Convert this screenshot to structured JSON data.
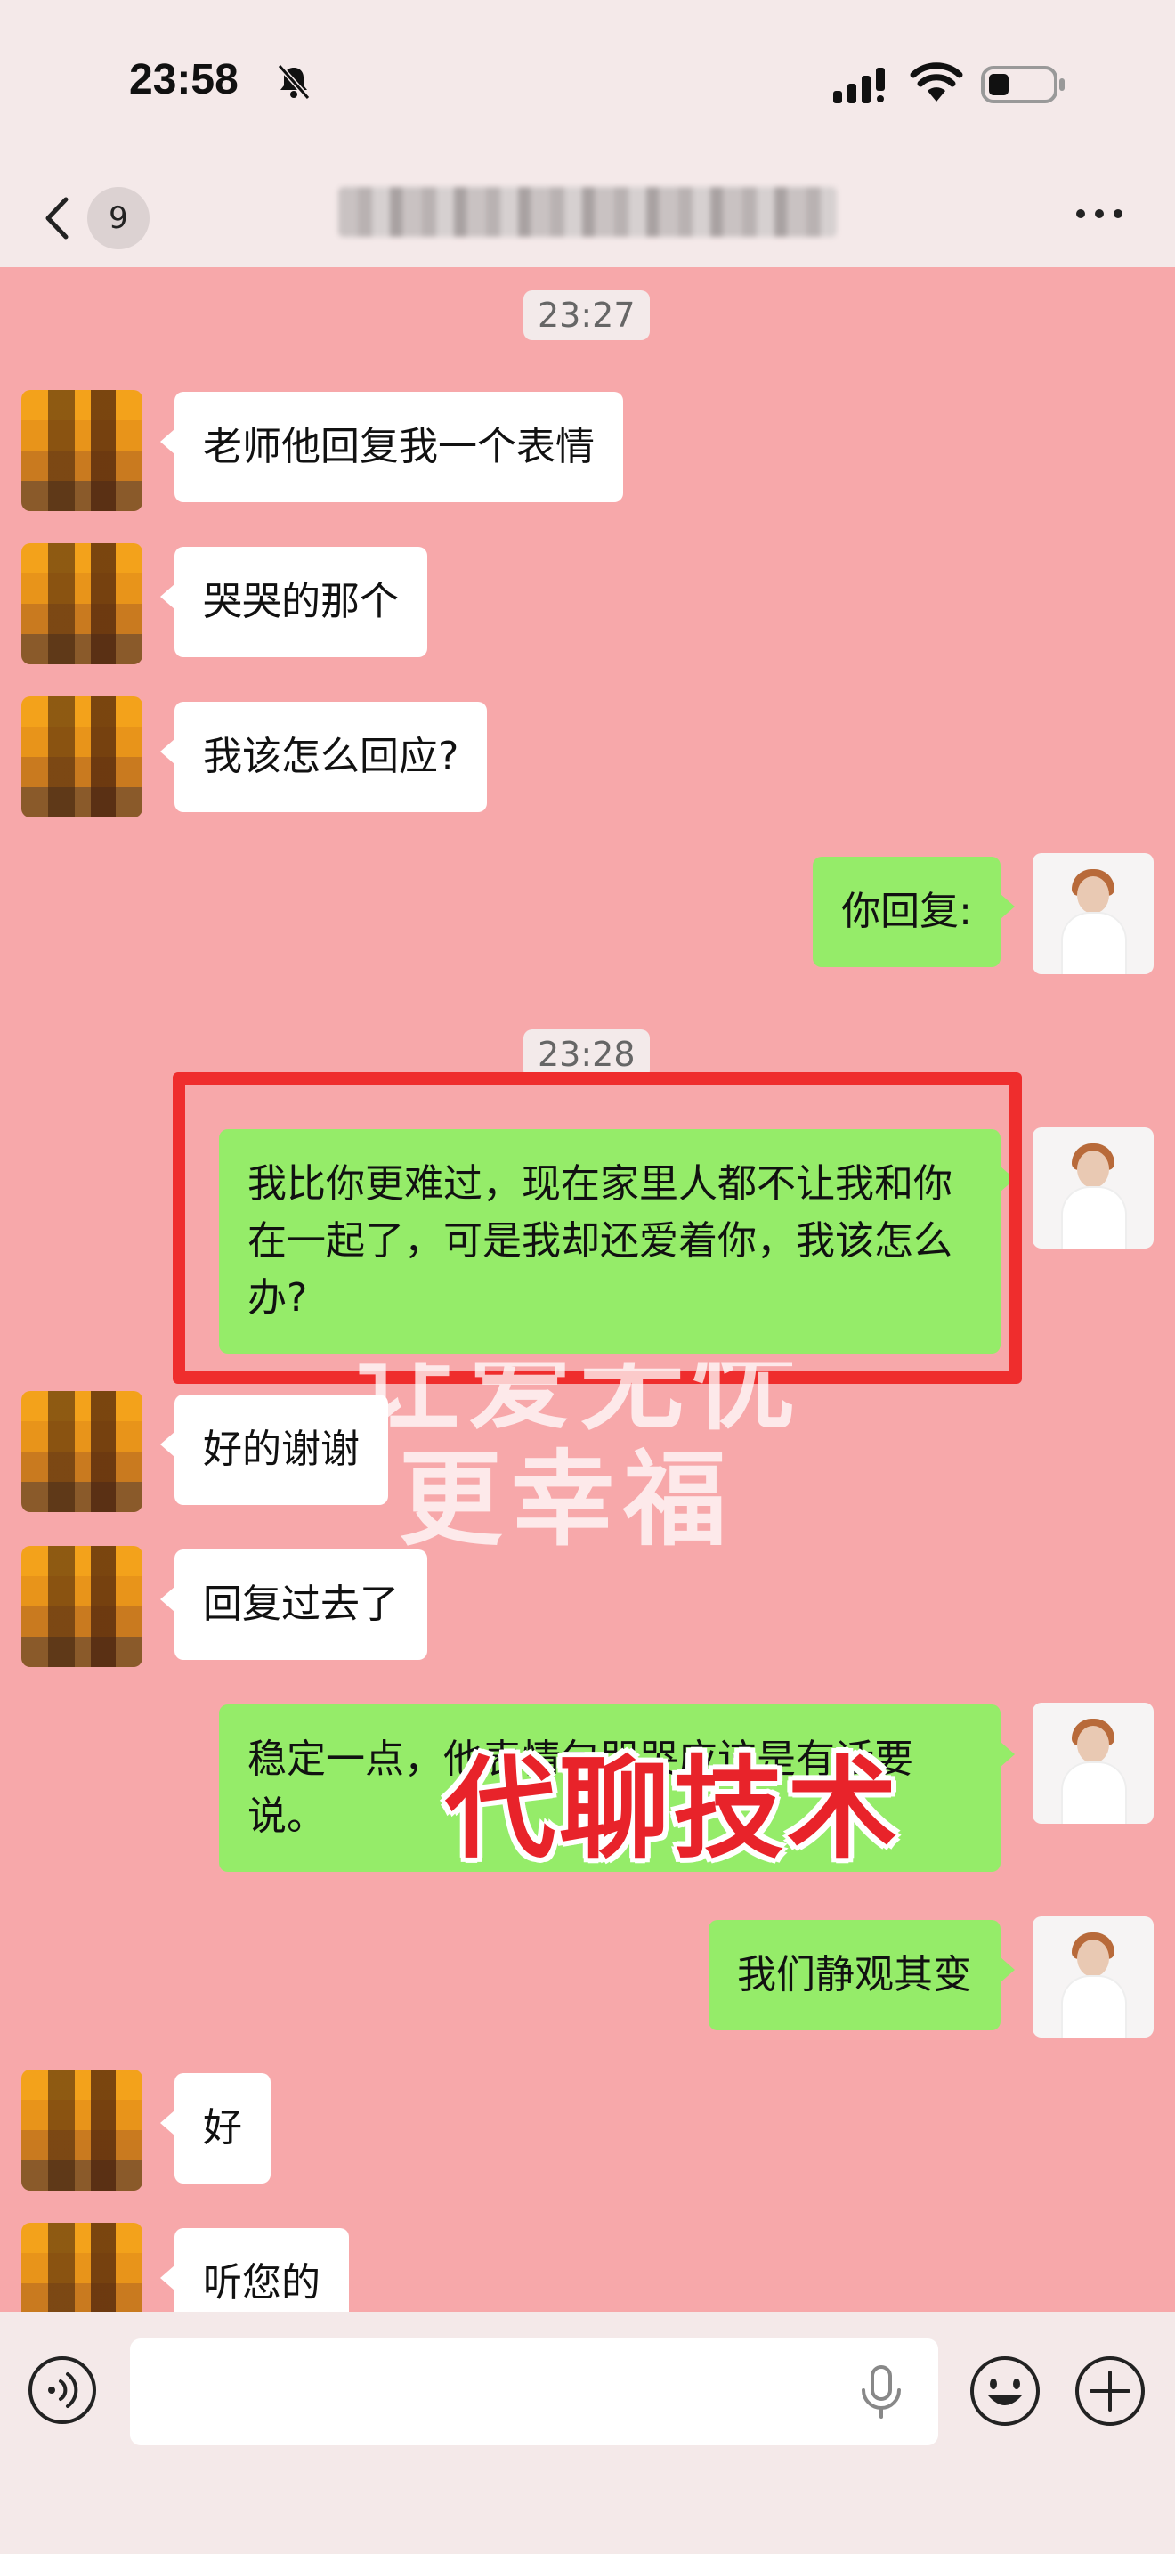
{
  "status_bar": {
    "time": "23:58",
    "icons": [
      "bell-slash-icon",
      "signal-icon",
      "wifi-icon",
      "battery-icon"
    ]
  },
  "nav": {
    "unread_count": "9",
    "back_icon": "chevron-left-icon",
    "more_icon": "ellipsis-icon"
  },
  "chat": {
    "time_1": "23:27",
    "time_2": "23:28",
    "messages": [
      {
        "from": "other",
        "text": "老师他回复我一个表情"
      },
      {
        "from": "other",
        "text": "哭哭的那个"
      },
      {
        "from": "other",
        "text": "我该怎么回应?"
      },
      {
        "from": "me",
        "text": "你回复:"
      },
      {
        "from": "me",
        "text": "我比你更难过，现在家里人都不让我和你在一起了，可是我却还爱着你，我该怎么办?"
      },
      {
        "from": "other",
        "text": "好的谢谢"
      },
      {
        "from": "other",
        "text": "回复过去了"
      },
      {
        "from": "me",
        "text": "稳定一点，他表情包哭哭应该是有话要说。"
      },
      {
        "from": "me",
        "text": "我们静观其变"
      },
      {
        "from": "other",
        "text": "好"
      },
      {
        "from": "other",
        "text": "听您的"
      }
    ]
  },
  "overlay": {
    "watermark_line_1": "让爱无忧",
    "watermark_line_2": "更幸福",
    "caption": "代聊技术",
    "caption_color": "#e8232a",
    "highlight_color": "#ef2d2d"
  },
  "input_bar": {
    "input_value": "",
    "icons": [
      "voice-icon",
      "microphone-icon",
      "emoji-icon",
      "plus-icon"
    ]
  },
  "colors": {
    "chat_background": "#f7a8aa",
    "my_bubble": "#95ec69",
    "their_bubble": "#ffffff",
    "bar_background": "#f4e9e9"
  }
}
